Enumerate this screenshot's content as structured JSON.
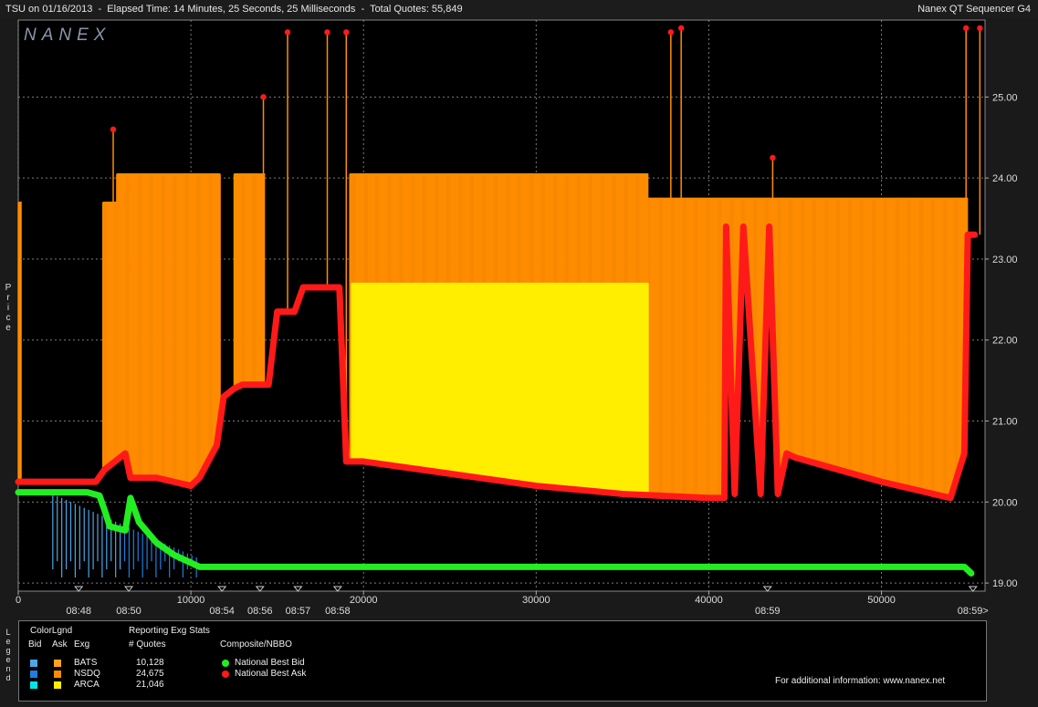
{
  "window": {
    "title_left": "TSU on 01/16/2013  -  Elapsed Time: 14 Minutes, 25 Seconds, 25 Milliseconds  -  Total Quotes: 55,849",
    "title_right": "Nanex QT Sequencer G4"
  },
  "watermark": "NANEX",
  "y_axis_label": "Price",
  "legend_side_label": "Legend",
  "legend": {
    "header_colorlegend": "ColorLgnd",
    "col_bid": "Bid",
    "col_ask": "Ask",
    "col_exg": "Exg",
    "header_stats": "Reporting Exg Stats",
    "col_quotes": "# Quotes",
    "header_nbbo": "Composite/NBBO",
    "exchanges": [
      {
        "name": "BATS",
        "quotes": "10,128",
        "bid_color": "#4aa8e8",
        "ask_color": "#ffa31a"
      },
      {
        "name": "NSDQ",
        "quotes": "24,675",
        "bid_color": "#1e7fe0",
        "ask_color": "#ff8c00"
      },
      {
        "name": "ARCA",
        "quotes": "21,046",
        "bid_color": "#00e5e5",
        "ask_color": "#ffee00"
      }
    ],
    "nbbo": [
      {
        "name": "National Best Bid",
        "color": "#22ee22"
      },
      {
        "name": "National Best Ask",
        "color": "#ff1a1a"
      }
    ],
    "info": "For additional information: www.nanex.net"
  },
  "chart_data": {
    "type": "line",
    "xlim": [
      0,
      56000
    ],
    "ylim": [
      18.9,
      25.95
    ],
    "x_ticks": [
      0,
      10000,
      20000,
      30000,
      40000,
      50000
    ],
    "x_tick_labels": [
      "0",
      "10000",
      "20000",
      "30000",
      "40000",
      "50000"
    ],
    "y_ticks": [
      19,
      20,
      21,
      22,
      23,
      24,
      25
    ],
    "y_tick_labels": [
      "19.00",
      "20.00",
      "21.00",
      "22.00",
      "23.00",
      "24.00",
      "25.00"
    ],
    "time_marks": [
      {
        "x": 3500,
        "label": "08:48"
      },
      {
        "x": 6400,
        "label": "08:50"
      },
      {
        "x": 11800,
        "label": "08:54"
      },
      {
        "x": 14000,
        "label": "08:56"
      },
      {
        "x": 16200,
        "label": "08:57"
      },
      {
        "x": 18500,
        "label": "08:58"
      },
      {
        "x": 43400,
        "label": "08:59"
      },
      {
        "x": 55300,
        "label": "08:59>"
      }
    ],
    "series": [
      {
        "name": "National Best Ask",
        "color": "#ff1a1a",
        "x": [
          0,
          4500,
          5000,
          6200,
          6500,
          8000,
          9000,
          10000,
          10500,
          11500,
          11900,
          12500,
          13000,
          14000,
          14500,
          15000,
          16000,
          16500,
          17000,
          18000,
          18600,
          19000,
          20000,
          25000,
          30000,
          35000,
          40000,
          40900,
          41000,
          41500,
          42000,
          43000,
          43500,
          44000,
          44500,
          45000,
          50000,
          54000,
          54800,
          55000,
          55400
        ],
        "y": [
          20.25,
          20.25,
          20.4,
          20.6,
          20.3,
          20.3,
          20.25,
          20.2,
          20.3,
          20.7,
          21.3,
          21.4,
          21.45,
          21.45,
          21.45,
          22.35,
          22.35,
          22.65,
          22.65,
          22.65,
          22.65,
          20.5,
          20.5,
          20.35,
          20.2,
          20.1,
          20.05,
          20.05,
          23.4,
          20.1,
          23.4,
          20.1,
          23.4,
          20.1,
          20.6,
          20.55,
          20.25,
          20.05,
          20.6,
          23.3,
          23.3
        ]
      },
      {
        "name": "National Best Bid",
        "color": "#22ee22",
        "x": [
          0,
          4000,
          4700,
          5000,
          5300,
          6200,
          6500,
          7000,
          8000,
          9000,
          10000,
          10500,
          20000,
          30000,
          40000,
          50000,
          54800,
          55200
        ],
        "y": [
          20.12,
          20.12,
          20.08,
          19.9,
          19.7,
          19.65,
          20.05,
          19.75,
          19.5,
          19.35,
          19.25,
          19.2,
          19.2,
          19.2,
          19.2,
          19.2,
          19.2,
          19.12
        ]
      }
    ],
    "ask_quotes": [
      {
        "exg": "NSDQ",
        "x_from": 0,
        "x_to": 200,
        "level": 23.7
      },
      {
        "exg": "NSDQ",
        "x_from": 4900,
        "x_to": 5700,
        "level": 23.7
      },
      {
        "exg": "NSDQ",
        "x_from": 5700,
        "x_to": 11700,
        "level": 24.05
      },
      {
        "exg": "NSDQ",
        "x_from": 12500,
        "x_to": 14300,
        "level": 24.05
      },
      {
        "exg": "NSDQ",
        "x_from": 19200,
        "x_to": 36500,
        "level": 24.05
      },
      {
        "exg": "NSDQ",
        "x_from": 36500,
        "x_to": 55000,
        "level": 23.75
      },
      {
        "exg": "ARCA",
        "x_from": 19300,
        "x_to": 36500,
        "level": 22.7
      }
    ],
    "peaks": [
      {
        "x": 5500,
        "y": 24.6
      },
      {
        "x": 14200,
        "y": 25.0
      },
      {
        "x": 15600,
        "y": 25.8
      },
      {
        "x": 17900,
        "y": 25.8
      },
      {
        "x": 19000,
        "y": 25.8
      },
      {
        "x": 37800,
        "y": 25.8
      },
      {
        "x": 38400,
        "y": 25.85
      },
      {
        "x": 43700,
        "y": 24.25
      },
      {
        "x": 54900,
        "y": 25.85
      },
      {
        "x": 55700,
        "y": 25.85
      }
    ]
  }
}
